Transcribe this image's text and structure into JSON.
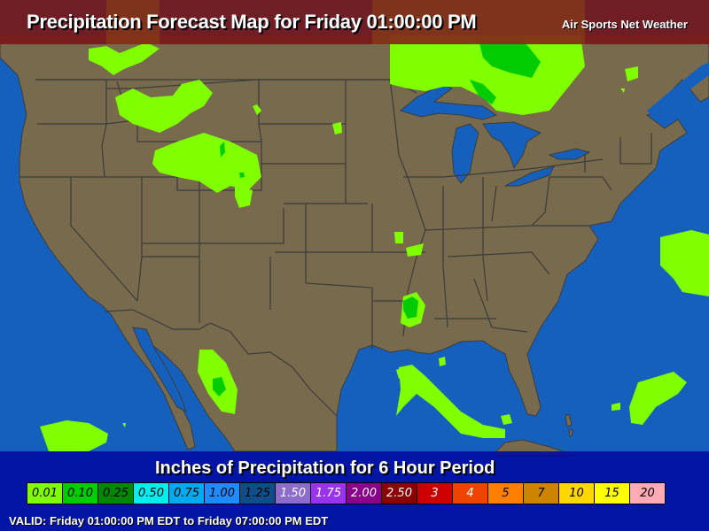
{
  "header": {
    "title": "Precipitation Forecast Map for Friday 01:00:00 PM",
    "brand": "Air Sports Net Weather"
  },
  "legend": {
    "title": "Inches of Precipitation for 6 Hour Period",
    "items": [
      {
        "label": "0.01",
        "color": "#80ff00",
        "text": "#000000"
      },
      {
        "label": "0.10",
        "color": "#00cc00",
        "text": "#000000"
      },
      {
        "label": "0.25",
        "color": "#008800",
        "text": "#000000"
      },
      {
        "label": "0.50",
        "color": "#00eeee",
        "text": "#000000"
      },
      {
        "label": "0.75",
        "color": "#00aaee",
        "text": "#000000"
      },
      {
        "label": "1.00",
        "color": "#1e8cff",
        "text": "#000000"
      },
      {
        "label": "1.25",
        "color": "#104e8b",
        "text": "#000000"
      },
      {
        "label": "1.50",
        "color": "#8c6ccc",
        "text": "#ffffff"
      },
      {
        "label": "1.75",
        "color": "#9933ee",
        "text": "#ffffff"
      },
      {
        "label": "2.00",
        "color": "#8b008b",
        "text": "#ffffff"
      },
      {
        "label": "2.50",
        "color": "#8b0000",
        "text": "#ffffff"
      },
      {
        "label": "3",
        "color": "#cc0000",
        "text": "#ffffff"
      },
      {
        "label": "4",
        "color": "#ee4400",
        "text": "#ffffff"
      },
      {
        "label": "5",
        "color": "#ff7f00",
        "text": "#000000"
      },
      {
        "label": "7",
        "color": "#cd8500",
        "text": "#000000"
      },
      {
        "label": "10",
        "color": "#ffd700",
        "text": "#000000"
      },
      {
        "label": "15",
        "color": "#ffff00",
        "text": "#000000"
      },
      {
        "label": "20",
        "color": "#ffaab4",
        "text": "#000000"
      }
    ]
  },
  "valid": "VALID: Friday 01:00:00 PM EDT to Friday 07:00:00 PM EDT",
  "colors": {
    "land": "#786a4c",
    "water": "#1560bd",
    "border": "#3c3c3c",
    "light_precip": "#80ff00",
    "medium_precip": "#00cc00"
  }
}
